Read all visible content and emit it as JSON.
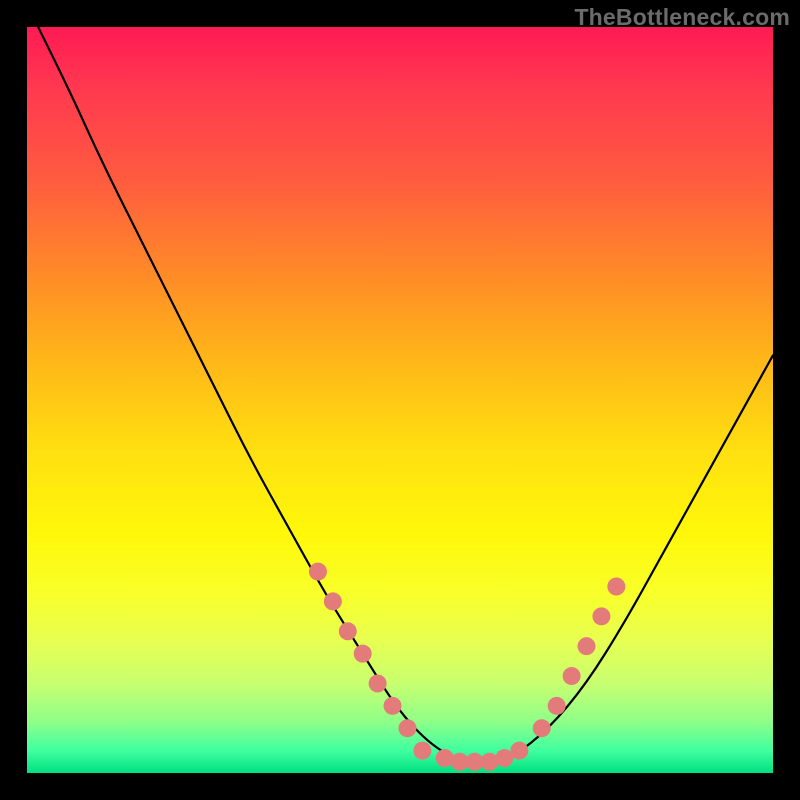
{
  "watermark": "TheBottleneck.com",
  "gradient_colors": {
    "top": "#ff1a54",
    "mid1": "#ff8a28",
    "mid2": "#ffe010",
    "mid3": "#f8ff2a",
    "bottom": "#00e080"
  },
  "dot_color": "#e47b7b",
  "curve_color": "#000000",
  "chart_data": {
    "type": "line",
    "title": "",
    "xlabel": "",
    "ylabel": "",
    "xlim": [
      0,
      100
    ],
    "ylim": [
      0,
      100
    ],
    "series": [
      {
        "name": "curve",
        "x": [
          0,
          5,
          10,
          15,
          20,
          25,
          30,
          35,
          40,
          45,
          50,
          55,
          60,
          65,
          70,
          75,
          80,
          85,
          90,
          95,
          100
        ],
        "y": [
          103,
          93,
          82,
          72,
          62,
          52,
          42,
          33,
          24,
          16,
          8,
          3,
          1,
          2,
          6,
          12,
          20,
          29,
          38,
          47,
          56
        ]
      }
    ],
    "markers": [
      {
        "x": 39,
        "y": 27
      },
      {
        "x": 41,
        "y": 23
      },
      {
        "x": 43,
        "y": 19
      },
      {
        "x": 45,
        "y": 16
      },
      {
        "x": 47,
        "y": 12
      },
      {
        "x": 49,
        "y": 9
      },
      {
        "x": 51,
        "y": 6
      },
      {
        "x": 53,
        "y": 3
      },
      {
        "x": 56,
        "y": 2
      },
      {
        "x": 58,
        "y": 1.5
      },
      {
        "x": 60,
        "y": 1.5
      },
      {
        "x": 62,
        "y": 1.5
      },
      {
        "x": 64,
        "y": 2
      },
      {
        "x": 66,
        "y": 3
      },
      {
        "x": 69,
        "y": 6
      },
      {
        "x": 71,
        "y": 9
      },
      {
        "x": 73,
        "y": 13
      },
      {
        "x": 75,
        "y": 17
      },
      {
        "x": 77,
        "y": 21
      },
      {
        "x": 79,
        "y": 25
      }
    ]
  }
}
